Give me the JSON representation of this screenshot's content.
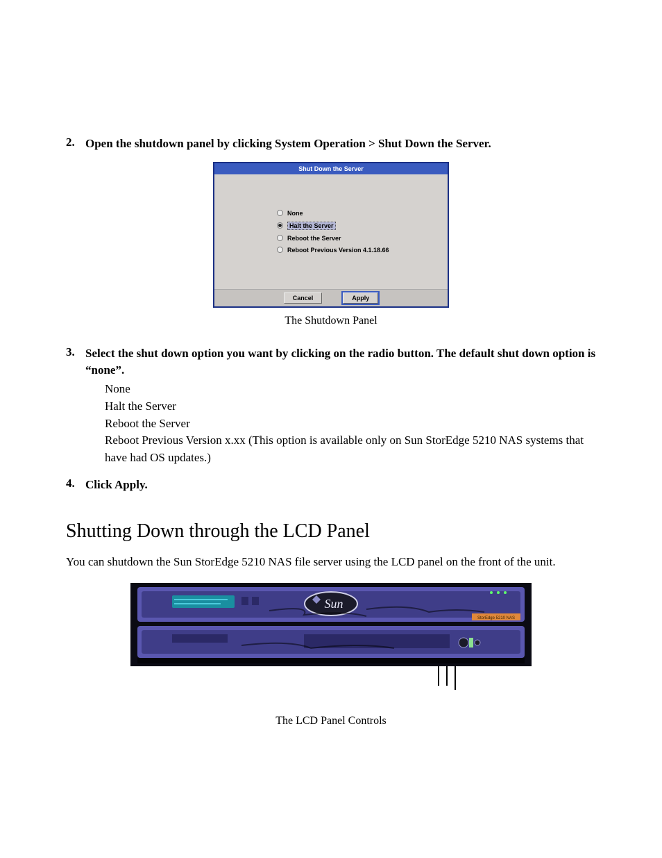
{
  "step2": {
    "num": "2.",
    "text": "Open the shutdown panel by clicking System Operation > Shut Down the Server."
  },
  "panel": {
    "title": "Shut Down the Server",
    "options": {
      "none": "None",
      "halt": "Halt the Server",
      "reboot": "Reboot the Server",
      "rebootPrev": "Reboot Previous Version 4.1.18.66"
    },
    "buttons": {
      "cancel": "Cancel",
      "apply": "Apply"
    }
  },
  "fig1_caption": "The Shutdown Panel",
  "step3": {
    "num": "3.",
    "text": "Select the shut down option you want by clicking on the radio button. The default shut down option is “none”."
  },
  "options_list": {
    "a": "None",
    "b": "Halt the Server",
    "c": "Reboot the Server",
    "d": "Reboot Previous Version x.xx (This option is available only on Sun StorEdge 5210 NAS systems that have had OS updates.)"
  },
  "step4": {
    "num": "4.",
    "text": "Click Apply."
  },
  "section_heading": "Shutting Down through the LCD Panel",
  "section_para": "You can shutdown the Sun StorEdge 5210 NAS file server using the LCD panel on the front of the unit.",
  "device": {
    "logo_text": "Sun",
    "side_label": "StorEdge 5210 NAS"
  },
  "fig2_caption": "The LCD Panel Controls"
}
